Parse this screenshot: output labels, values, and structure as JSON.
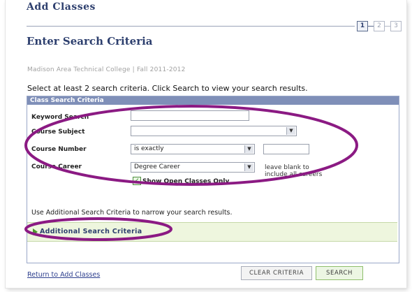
{
  "header": {
    "title": "Add Classes",
    "steps": [
      "1",
      "2",
      "3"
    ]
  },
  "subtitle": "Enter Search Criteria",
  "institution": "Madison Area Technical College | Fall 2011-2012",
  "instructions": "Select at least 2 search criteria. Click Search to view your search results.",
  "criteria": {
    "header": "Class Search Criteria",
    "keyword": {
      "label": "Keyword Search",
      "value": ""
    },
    "subject": {
      "label": "Course Subject",
      "value": ""
    },
    "number": {
      "label": "Course Number",
      "operator": "is exactly",
      "value": ""
    },
    "career": {
      "label": "Course Career",
      "value": "Degree Career",
      "note": "leave blank to include all careers"
    },
    "open_only": {
      "label": "Show Open Classes Only",
      "checked": true
    }
  },
  "additional": {
    "text": "Use Additional Search Criteria to narrow your search results.",
    "label": "Additional Search Criteria"
  },
  "footer": {
    "return_link": "Return to Add Classes",
    "clear_button": "CLEAR CRITERIA",
    "search_button": "SEARCH"
  },
  "colors": {
    "heading": "#2d3f6e",
    "criteria_bar": "#7f8fb8",
    "additional_bg": "#eef6de",
    "annotation": "#8b1a83"
  },
  "icons": {
    "dropdown": "chevron-down-icon",
    "expand": "triangle-right-icon",
    "checkbox": "checkmark-icon"
  }
}
